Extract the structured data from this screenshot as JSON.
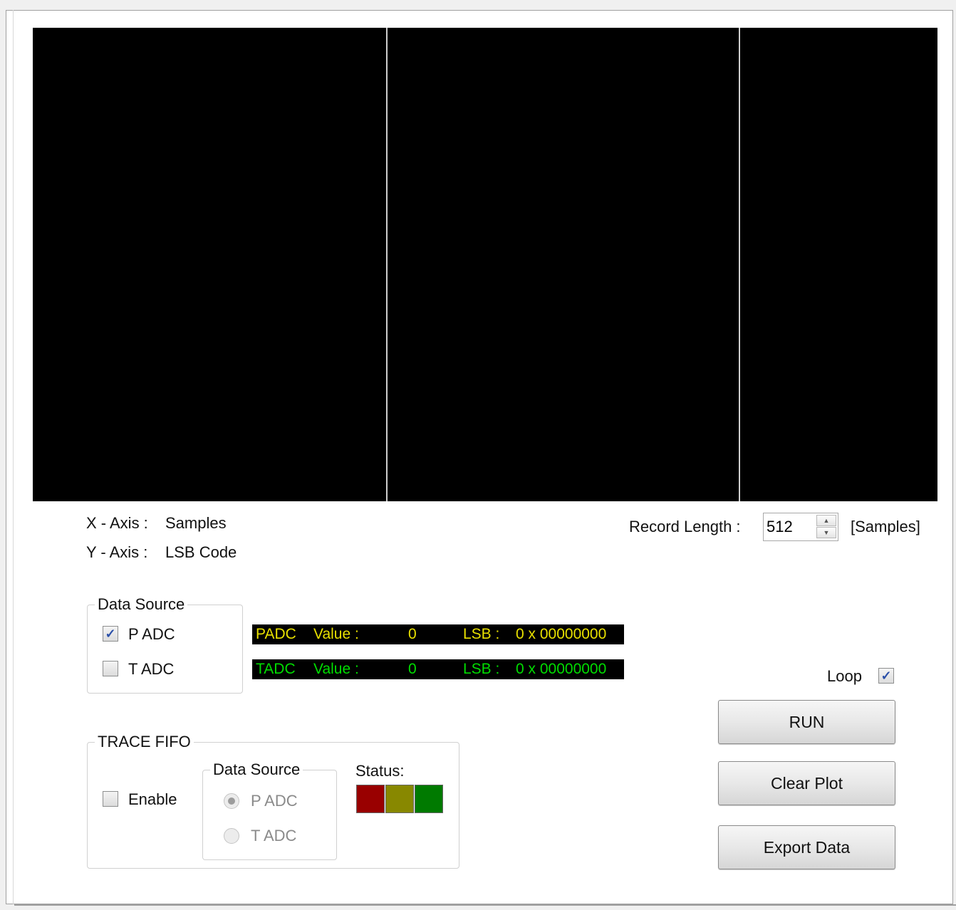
{
  "axes": {
    "x_label": "X - Axis :",
    "x_value": "Samples",
    "y_label": "Y - Axis :",
    "y_value": "LSB Code"
  },
  "record_length": {
    "label": "Record Length :",
    "value": "512",
    "unit": "[Samples]"
  },
  "data_source": {
    "legend": "Data Source",
    "padc_label": "P ADC",
    "padc_checked": true,
    "tadc_label": "T ADC",
    "tadc_checked": false
  },
  "readouts": {
    "padc": {
      "name": "PADC",
      "value_label": "Value :",
      "value": "0",
      "lsb_label": "LSB :",
      "lsb": "0 x 00000000",
      "color": "#e8e000"
    },
    "tadc": {
      "name": "TADC",
      "value_label": "Value :",
      "value": "0",
      "lsb_label": "LSB :",
      "lsb": "0 x 00000000",
      "color": "#00dd00"
    }
  },
  "trace_fifo": {
    "legend": "TRACE FIFO",
    "enable_label": "Enable",
    "enable_checked": false,
    "data_source_legend": "Data Source",
    "padc_label": "P ADC",
    "tadc_label": "T ADC",
    "status_label": "Status:",
    "status_colors": [
      "#990000",
      "#888800",
      "#007a00"
    ]
  },
  "loop": {
    "label": "Loop",
    "checked": true
  },
  "buttons": {
    "run": "RUN",
    "clear_plot": "Clear Plot",
    "export_data": "Export Data"
  }
}
